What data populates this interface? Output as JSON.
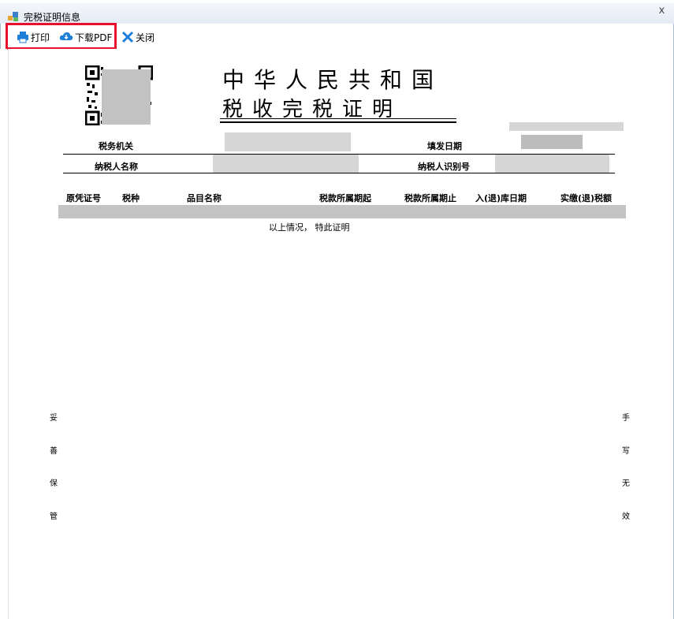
{
  "window": {
    "title": "完税证明信息",
    "close_glyph": "x"
  },
  "toolbar": {
    "print_label": "打印",
    "download_label": "下载PDF",
    "close_label": "关闭"
  },
  "certificate": {
    "title_line1": "中华人民共和国",
    "title_line2": "税收完税证明",
    "tax_office_label": "税务机关",
    "fill_date_label": "填发日期",
    "taxpayer_name_label": "纳税人名称",
    "taxpayer_id_label": "纳税人识别号",
    "columns": [
      "原凭证号",
      "税种",
      "品目名称",
      "税款所属期起",
      "税款所属期止",
      "入(退)库日期",
      "实缴(退)税额"
    ],
    "closing_note": "以上情况， 特此证明",
    "left_vertical": [
      "妥",
      "善",
      "保",
      "管"
    ],
    "right_vertical": [
      "手",
      "写",
      "无",
      "效"
    ]
  },
  "colors": {
    "highlight_border": "#e8102a",
    "icon_blue": "#1e7fd8",
    "redaction_grey": "#c4c4c4"
  }
}
